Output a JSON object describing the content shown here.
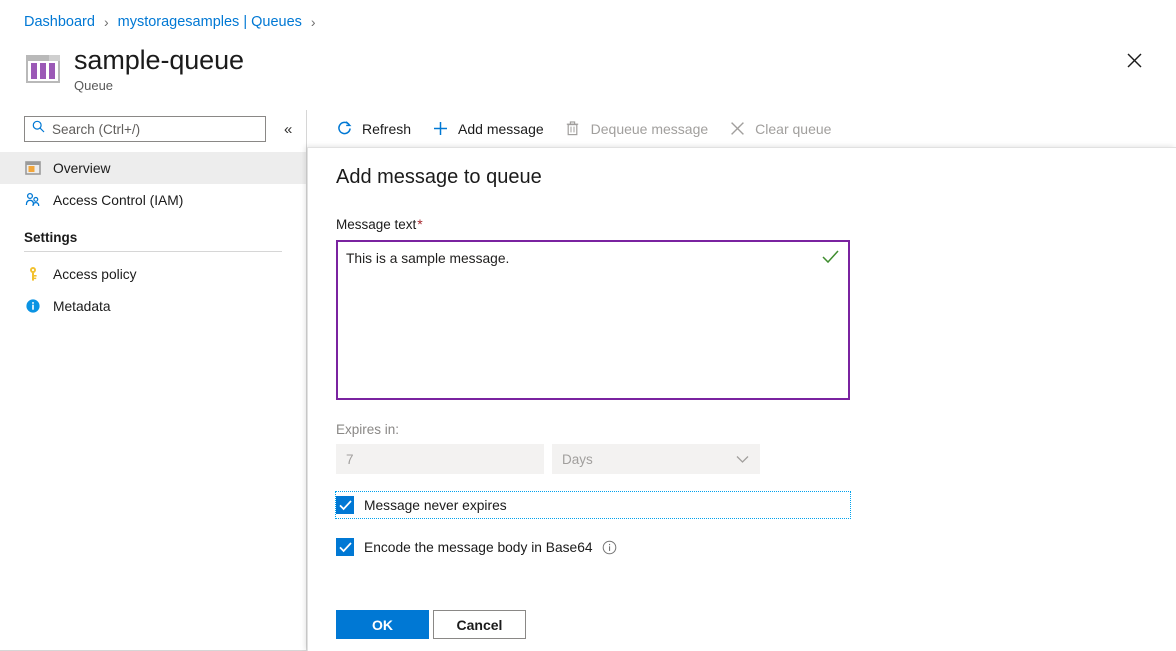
{
  "breadcrumb": {
    "items": [
      {
        "label": "Dashboard"
      },
      {
        "label": "mystoragesamples | Queues"
      }
    ],
    "separator": "›"
  },
  "header": {
    "title": "sample-queue",
    "subtitle": "Queue",
    "icon": "queue-icon",
    "close_label": "✕"
  },
  "sidebar": {
    "search": {
      "placeholder": "Search (Ctrl+/)",
      "icon": "search-icon"
    },
    "collapse_label": "«",
    "items": [
      {
        "label": "Overview",
        "icon": "overview-icon",
        "active": true
      },
      {
        "label": "Access Control (IAM)",
        "icon": "people-icon",
        "active": false
      }
    ],
    "section_title": "Settings",
    "settings_items": [
      {
        "label": "Access policy",
        "icon": "key-icon"
      },
      {
        "label": "Metadata",
        "icon": "info-circle-icon"
      }
    ]
  },
  "toolbar": {
    "buttons": [
      {
        "label": "Refresh",
        "icon": "refresh-icon",
        "disabled": false
      },
      {
        "label": "Add message",
        "icon": "plus-icon",
        "disabled": false
      },
      {
        "label": "Dequeue message",
        "icon": "trash-icon",
        "disabled": true
      },
      {
        "label": "Clear queue",
        "icon": "close-x-icon",
        "disabled": true
      }
    ]
  },
  "dialog": {
    "title": "Add message to queue",
    "message_field": {
      "label": "Message text",
      "required_marker": "*",
      "value": "This is a sample message.",
      "validation_icon": "checkmark-icon"
    },
    "expires": {
      "label": "Expires in:",
      "number_value": "7",
      "unit_value": "Days",
      "unit_chevron": "chevron-down-icon"
    },
    "checkboxes": [
      {
        "label": "Message never expires",
        "checked": true,
        "focused": true
      },
      {
        "label": "Encode the message body in Base64",
        "checked": true,
        "focused": false,
        "info_icon": "info-icon"
      }
    ],
    "ok_label": "OK",
    "cancel_label": "Cancel"
  },
  "colors": {
    "accent": "#0078d4",
    "link": "#0078d4",
    "focus_border": "#7a23a0",
    "valid": "#3f8d2f",
    "required": "#a4262c",
    "disabled_text": "#a19f9d"
  }
}
